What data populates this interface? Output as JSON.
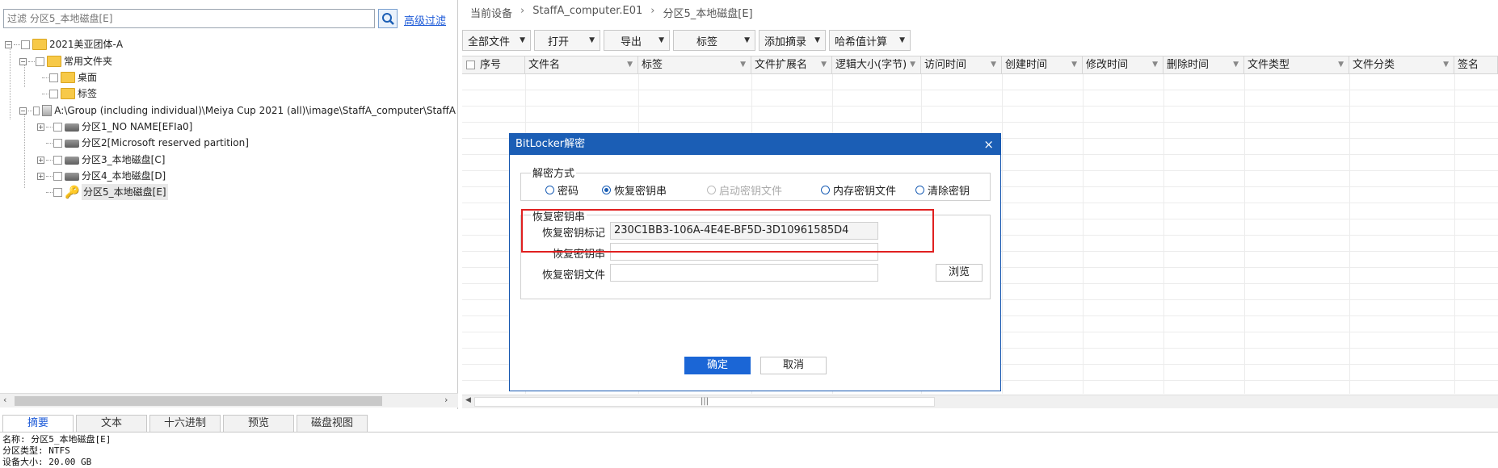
{
  "left": {
    "filter_placeholder": "过滤 分区5_本地磁盘[E]",
    "advanced_filter": "高级过滤",
    "tree": [
      {
        "label": "2021美亚团体-A"
      },
      {
        "label": "常用文件夹"
      },
      {
        "label": "桌面"
      },
      {
        "label": "标签"
      },
      {
        "label": "A:\\Group (including individual)\\Meiya Cup 2021 (all)\\image\\StaffA_computer\\StaffA"
      },
      {
        "label": "分区1_NO NAME[EFIa0]"
      },
      {
        "label": "分区2[Microsoft reserved partition]"
      },
      {
        "label": "分区3_本地磁盘[C]"
      },
      {
        "label": "分区4_本地磁盘[D]"
      },
      {
        "label": "分区5_本地磁盘[E]"
      }
    ]
  },
  "breadcrumb": [
    "当前设备",
    "StaffA_computer.E01",
    "分区5_本地磁盘[E]"
  ],
  "toolbar": [
    {
      "label": "全部文件"
    },
    {
      "label": "打开"
    },
    {
      "label": "导出"
    },
    {
      "label": "标签"
    },
    {
      "label": "添加摘录"
    },
    {
      "label": "哈希值计算"
    }
  ],
  "columns": [
    "序号",
    "文件名",
    "标签",
    "文件扩展名",
    "逻辑大小(字节)",
    "访问时间",
    "创建时间",
    "修改时间",
    "删除时间",
    "文件类型",
    "文件分类",
    "签名"
  ],
  "dialog": {
    "title": "BitLocker解密",
    "close": "×",
    "method_group": "解密方式",
    "methods": [
      {
        "label": "密码",
        "checked": false,
        "enabled": true
      },
      {
        "label": "恢复密钥串",
        "checked": true,
        "enabled": true
      },
      {
        "label": "启动密钥文件",
        "checked": false,
        "enabled": false
      },
      {
        "label": "内存密钥文件",
        "checked": false,
        "enabled": true
      },
      {
        "label": "清除密钥",
        "checked": false,
        "enabled": true
      }
    ],
    "key_group": "恢复密钥串",
    "key_id_label": "恢复密钥标记",
    "key_id_value": "230C1BB3-106A-4E4E-BF5D-3D10961585D4",
    "recovery_key_label": "恢复密钥串",
    "recovery_key_value": "",
    "recovery_file_label": "恢复密钥文件",
    "recovery_file_value": "",
    "browse": "浏览",
    "ok": "确定",
    "cancel": "取消"
  },
  "bottom_tabs": [
    "摘要",
    "文本",
    "十六进制",
    "预览",
    "磁盘视图"
  ],
  "details": [
    "名称: 分区5_本地磁盘[E]",
    "分区类型: NTFS",
    "设备大小: 20.00 GB"
  ],
  "colors": {
    "accent": "#1b5eb5",
    "highlight": "#e02020",
    "link": "#1e5bd8"
  }
}
